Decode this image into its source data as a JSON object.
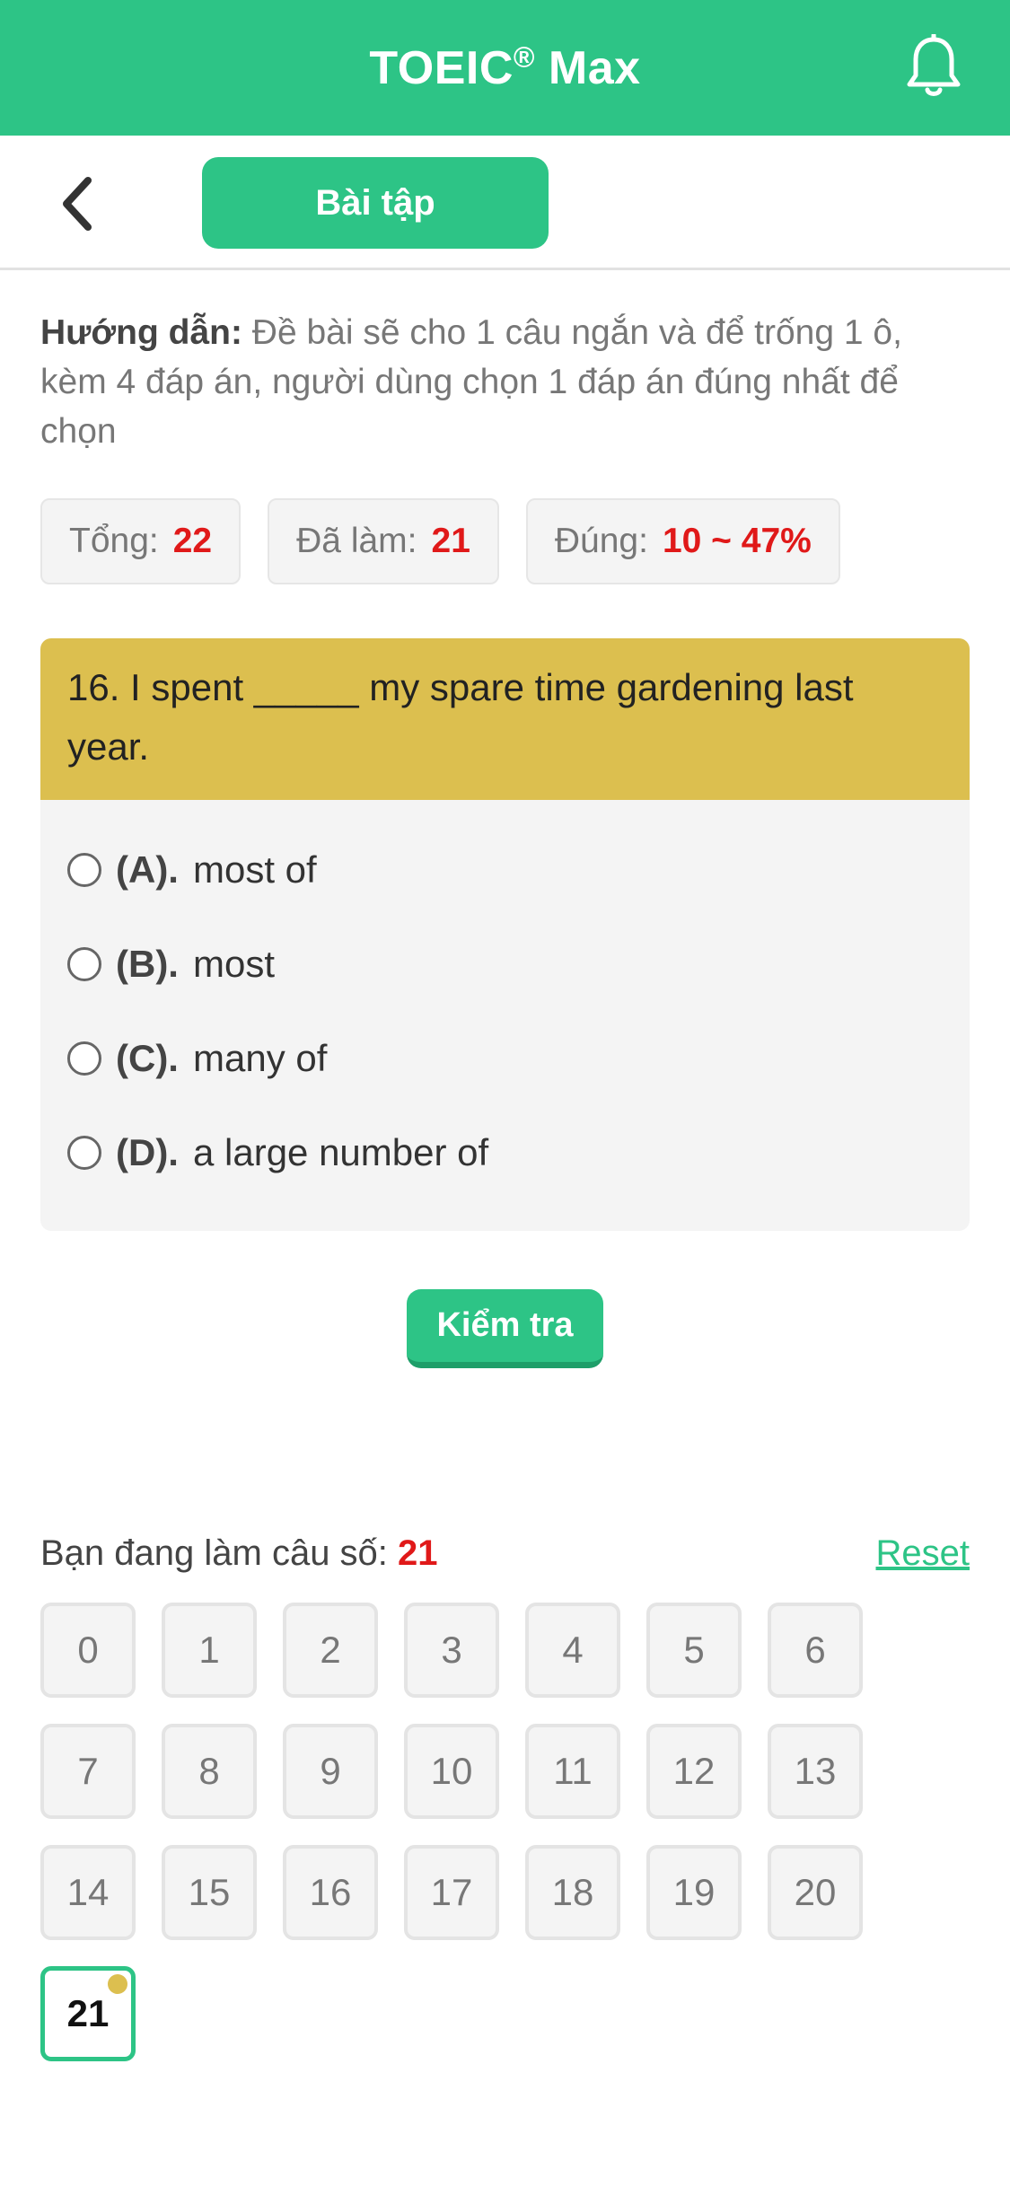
{
  "header": {
    "title_main": "TOEIC",
    "title_reg": "®",
    "title_rest": " Max",
    "bell_icon": "bell-icon"
  },
  "subheader": {
    "back_icon": "chevron-left-icon",
    "tab_label": "Bài tập"
  },
  "guide": {
    "label": "Hướng dẫn:",
    "text": " Đề bài sẽ cho 1 câu ngắn và để trống 1 ô, kèm 4 đáp án, người dùng chọn 1 đáp án đúng nhất để chọn"
  },
  "stats": {
    "total_label": "Tổng:",
    "total_value": "22",
    "done_label": "Đã làm:",
    "done_value": "21",
    "correct_label": "Đúng:",
    "correct_value": "10 ~ 47%"
  },
  "question": {
    "text": "16. I spent _____ my spare time gardening last year.",
    "options": [
      {
        "letter": "(A).",
        "text": "most of"
      },
      {
        "letter": "(B).",
        "text": "most"
      },
      {
        "letter": "(C).",
        "text": "many of"
      },
      {
        "letter": "(D).",
        "text": "a large number of"
      }
    ]
  },
  "check_button": "Kiểm tra",
  "progress": {
    "label": "Bạn đang làm câu số: ",
    "value": "21",
    "reset_label": "Reset"
  },
  "grid": {
    "numbers": [
      "0",
      "1",
      "2",
      "3",
      "4",
      "5",
      "6",
      "7",
      "8",
      "9",
      "10",
      "11",
      "12",
      "13",
      "14",
      "15",
      "16",
      "17",
      "18",
      "19",
      "20",
      "21"
    ],
    "current": "21",
    "accent": "#dcbf4f"
  },
  "colors": {
    "brand": "#2dc486",
    "question_bg": "#dcbf4f",
    "value_red": "#e01919"
  }
}
